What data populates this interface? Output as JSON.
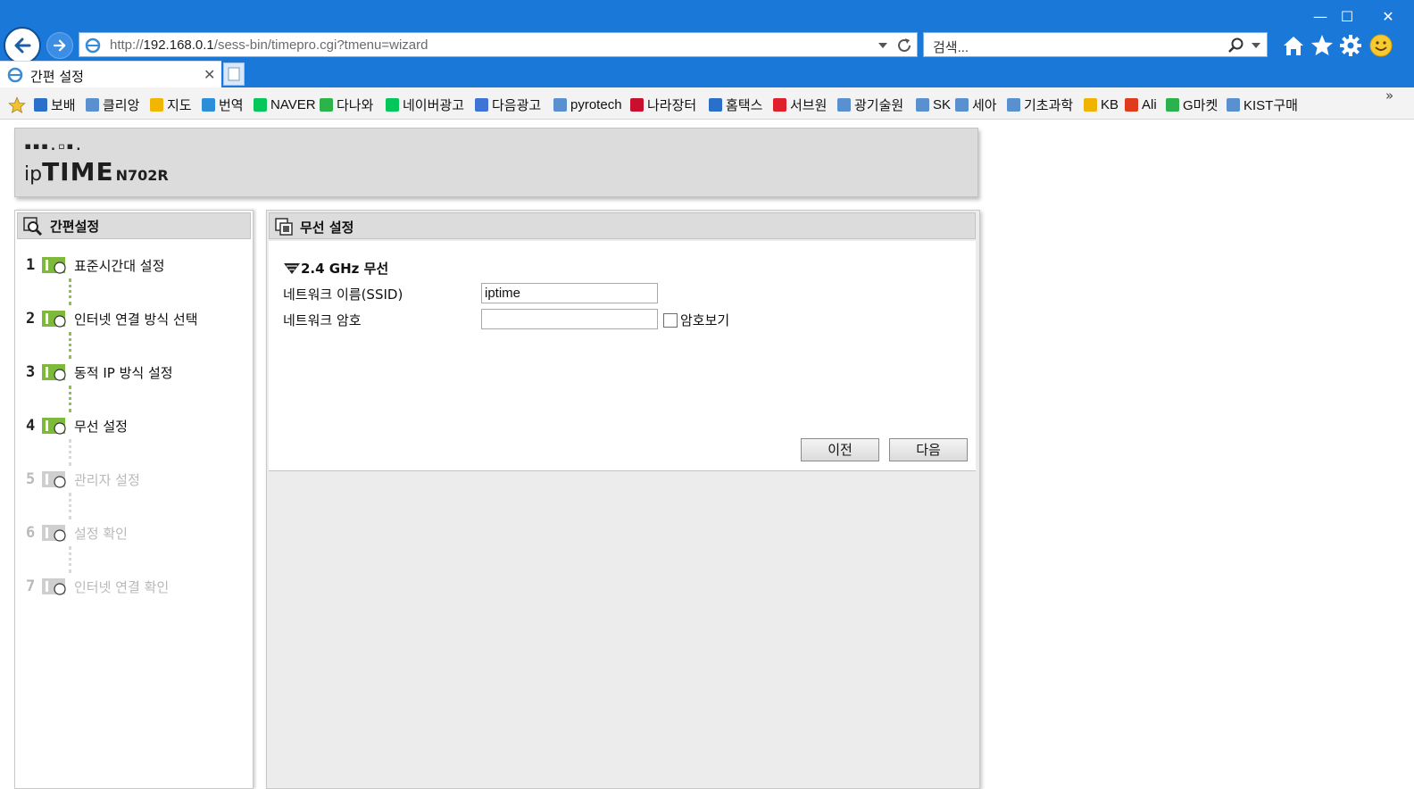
{
  "browser": {
    "window_controls": {
      "minimize": "—",
      "maximize": "☐",
      "close": "✕"
    },
    "url_prefix": "http://",
    "url_host": "192.168.0.1",
    "url_path": "/sess-bin/timepro.cgi?tmenu=wizard",
    "search_placeholder": "검색...",
    "tab_title": "간편 설정",
    "tab_close": "✕",
    "favorites": [
      {
        "label": "보배",
        "color": "#2a6fc9"
      },
      {
        "label": "클리앙",
        "color": "#5a8fd0"
      },
      {
        "label": "지도",
        "color": "#f2b600"
      },
      {
        "label": "번역",
        "color": "#2a8fd8"
      },
      {
        "label": "NAVER",
        "color": "#03c75a"
      },
      {
        "label": "다나와",
        "color": "#2cb34a"
      },
      {
        "label": "네이버광고",
        "color": "#03c75a"
      },
      {
        "label": "다음광고",
        "color": "#3e74d6"
      },
      {
        "label": "pyrotech",
        "color": "#5a8fd0"
      },
      {
        "label": "나라장터",
        "color": "#c8102e"
      },
      {
        "label": "홈택스",
        "color": "#2a6fc9"
      },
      {
        "label": "서브원",
        "color": "#e0202a"
      },
      {
        "label": "광기술원",
        "color": "#5a8fd0"
      },
      {
        "label": "SK",
        "color": "#5a8fd0"
      },
      {
        "label": "세아",
        "color": "#5a8fd0"
      },
      {
        "label": "기초과학",
        "color": "#5a8fd0"
      },
      {
        "label": "KB",
        "color": "#f0b400"
      },
      {
        "label": "Ali",
        "color": "#e03b1d"
      },
      {
        "label": "G마켓",
        "color": "#2bb24c"
      },
      {
        "label": "KIST구매",
        "color": "#5a8fd0"
      }
    ],
    "favorites_overflow": "»"
  },
  "router": {
    "logo_dots": "▪▪▪.▫▪.",
    "logo_ip": "ip",
    "logo_time": "TIME",
    "logo_model": "N702R",
    "sidebar_title": "간편설정",
    "steps": [
      {
        "num": "1",
        "label": "표준시간대 설정",
        "active": true
      },
      {
        "num": "2",
        "label": "인터넷 연결 방식 선택",
        "active": true
      },
      {
        "num": "3",
        "label": "동적 IP 방식 설정",
        "active": true
      },
      {
        "num": "4",
        "label": "무선 설정",
        "active": true
      },
      {
        "num": "5",
        "label": "관리자 설정",
        "active": false
      },
      {
        "num": "6",
        "label": "설정 확인",
        "active": false
      },
      {
        "num": "7",
        "label": "인터넷 연결 확인",
        "active": false
      }
    ],
    "main_title": "무선 설정",
    "section_title": "2.4 GHz 무선",
    "ssid_label": "네트워크 이름(SSID)",
    "ssid_value": "iptime",
    "password_label": "네트워크 암호",
    "password_value": "",
    "show_password_label": "암호보기",
    "prev_button": "이전",
    "next_button": "다음"
  },
  "colors": {
    "chrome_blue": "#1a79d8",
    "step_green": "#7dba3c",
    "step_dim": "#cfcfcf"
  }
}
